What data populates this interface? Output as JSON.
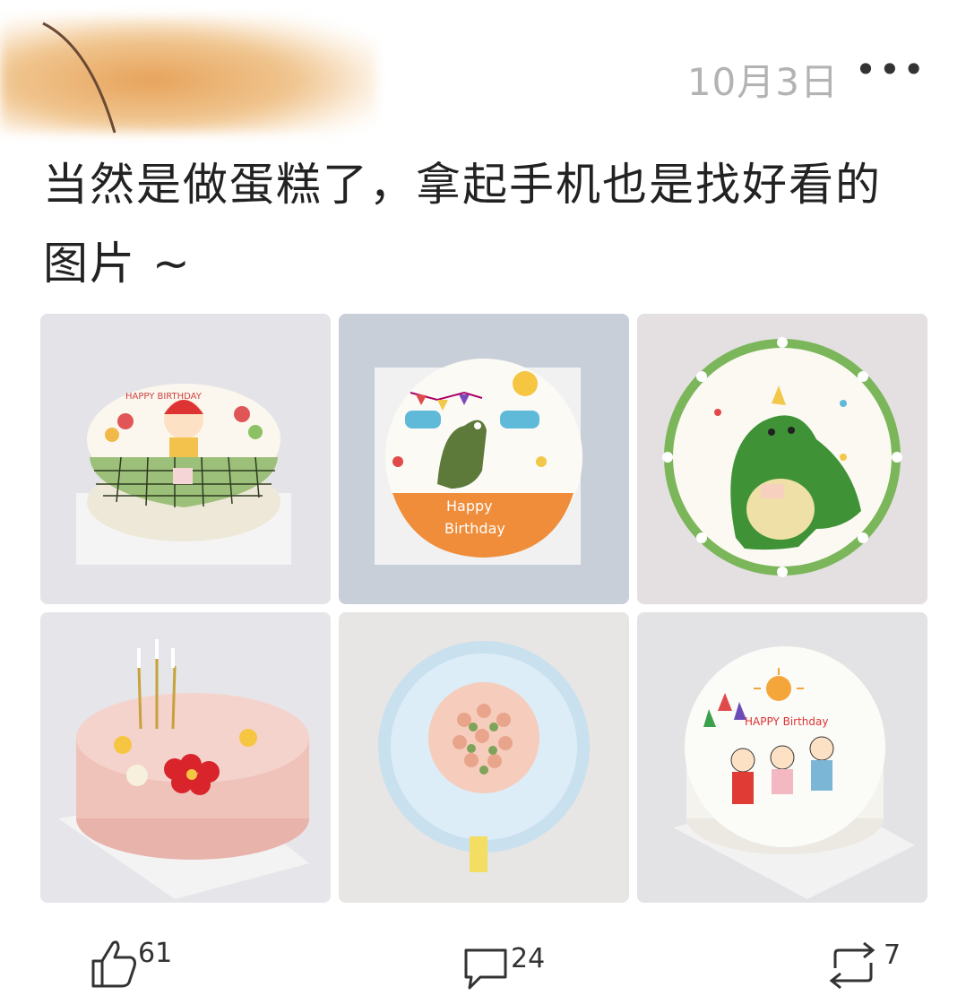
{
  "post": {
    "date": "10月3日",
    "more_label": "•••",
    "text_line1": "当然是做蛋糕了，拿起手机也是找好看的",
    "text_line2": "图片 ~"
  },
  "images": [
    {
      "name": "girl-cake",
      "decoration": "HAPPY BIRTHDAY"
    },
    {
      "name": "dinosaur-orange-cake",
      "decoration": "Happy Birthday"
    },
    {
      "name": "green-dinosaur-cake"
    },
    {
      "name": "pink-flower-cake"
    },
    {
      "name": "blue-ruffle-rose-cake"
    },
    {
      "name": "family-drawing-cake",
      "decoration": "HAPPY Birthday"
    }
  ],
  "actions": {
    "like_count": "61",
    "comment_count": "24",
    "repost_count": "7"
  },
  "icons": {
    "like": "thumbs-up-icon",
    "comment": "comment-bubble-icon",
    "repost": "repost-icon"
  }
}
